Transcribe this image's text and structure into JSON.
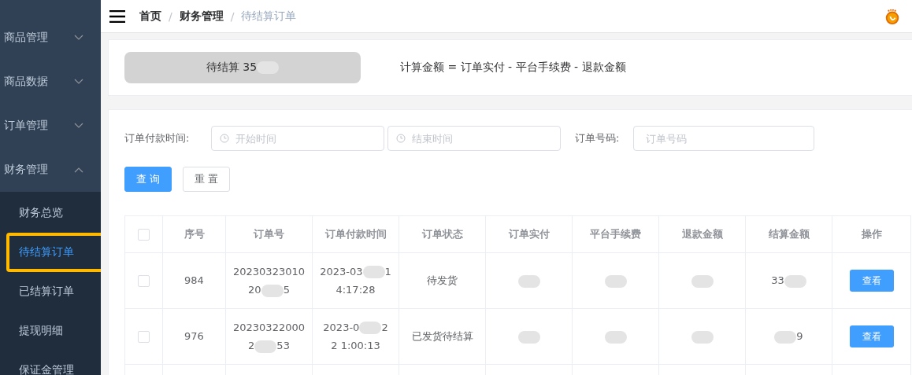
{
  "sidebar": {
    "items": [
      {
        "label": "商品管理",
        "expanded": false
      },
      {
        "label": "商品数据",
        "expanded": false
      },
      {
        "label": "订单管理",
        "expanded": false
      },
      {
        "label": "财务管理",
        "expanded": true,
        "children": [
          {
            "label": "财务总览",
            "selected": false,
            "highlighted": false
          },
          {
            "label": "待结算订单",
            "selected": true,
            "highlighted": true
          },
          {
            "label": "已结算订单",
            "selected": false,
            "highlighted": false
          },
          {
            "label": "提现明细",
            "selected": false,
            "highlighted": false
          },
          {
            "label": "保证金管理",
            "selected": false,
            "highlighted": false
          }
        ]
      }
    ]
  },
  "breadcrumb": {
    "separator": "/",
    "items": [
      "首页",
      "财务管理",
      "待结算订单"
    ]
  },
  "summary": {
    "pending": [
      {
        "kind": "text",
        "text": "待结算 35"
      },
      {
        "kind": "blur"
      }
    ],
    "formula": "计算金额 = 订单实付 - 平台手续费 - 退款金额"
  },
  "filters": {
    "pay_time_label": "订单付款时间:",
    "start_placeholder": "开始时间",
    "end_placeholder": "结束时间",
    "order_no_label": "订单号码:",
    "order_no_placeholder": "订单号码",
    "buttons": [
      {
        "label": "查 询",
        "kind": "primary"
      },
      {
        "label": "重 置",
        "kind": "default"
      }
    ]
  },
  "table": {
    "select_all_checked": false,
    "columns": [
      "序号",
      "订单号",
      "订单付款时间",
      "订单状态",
      "订单实付",
      "平台手续费",
      "退款金额",
      "结算金额",
      "操作"
    ],
    "rows": [
      {
        "checked": false,
        "cells": [
          [
            {
              "kind": "text",
              "text": "984"
            }
          ],
          [
            {
              "kind": "text",
              "text": "20230323010 20"
            },
            {
              "kind": "blur"
            },
            {
              "kind": "text",
              "text": "5"
            }
          ],
          [
            {
              "kind": "text",
              "text": "2023-03"
            },
            {
              "kind": "blur"
            },
            {
              "kind": "text",
              "text": "1 4:17:28"
            }
          ],
          [
            {
              "kind": "text",
              "text": "待发货"
            }
          ],
          [
            {
              "kind": "blur"
            }
          ],
          [
            {
              "kind": "blur"
            }
          ],
          [
            {
              "kind": "blur"
            }
          ],
          [
            {
              "kind": "text",
              "text": "33"
            },
            {
              "kind": "blur"
            }
          ]
        ],
        "action": "查看"
      },
      {
        "checked": false,
        "cells": [
          [
            {
              "kind": "text",
              "text": "976"
            }
          ],
          [
            {
              "kind": "text",
              "text": "20230322000 2"
            },
            {
              "kind": "blur"
            },
            {
              "kind": "text",
              "text": "53"
            }
          ],
          [
            {
              "kind": "text",
              "text": "2023-0"
            },
            {
              "kind": "blur"
            },
            {
              "kind": "text",
              "text": "2 2 1:00:13"
            }
          ],
          [
            {
              "kind": "text",
              "text": "已发货待结算"
            }
          ],
          [
            {
              "kind": "blur"
            }
          ],
          [
            {
              "kind": "blur"
            }
          ],
          [
            {
              "kind": "blur"
            }
          ],
          [
            {
              "kind": "blur"
            },
            {
              "kind": "text",
              "text": "9"
            }
          ]
        ],
        "action": "查看"
      }
    ]
  }
}
